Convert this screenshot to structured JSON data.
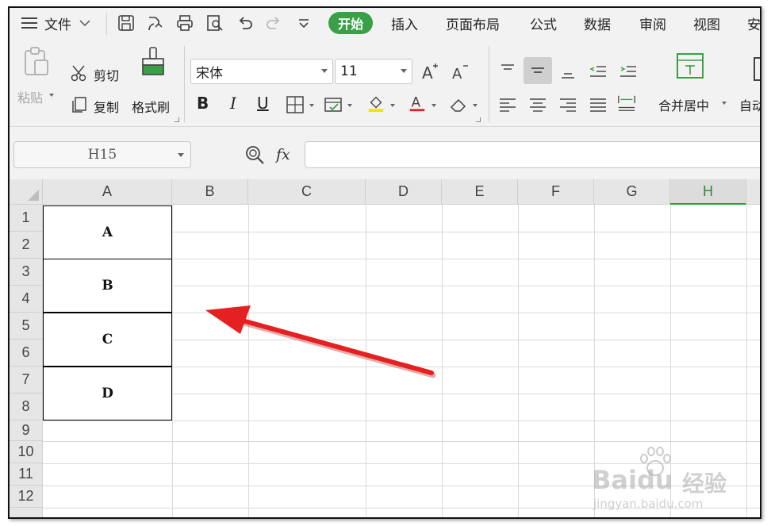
{
  "menu": {
    "hamburger_icon": "hamburger-menu-icon",
    "file_label": "文件",
    "tabs": [
      "开始",
      "插入",
      "页面布局",
      "公式",
      "数据",
      "审阅",
      "视图",
      "安"
    ],
    "active_tab": "开始",
    "active_color": "#3aa047"
  },
  "ribbon": {
    "paste_label": "粘贴",
    "cut_label": "剪切",
    "copy_label": "复制",
    "format_painter_label": "格式刷",
    "font_name": "宋体",
    "font_size": "11",
    "merge_center_label": "合并居中",
    "wrap_label": "自动"
  },
  "formula_bar": {
    "cell_ref": "H15",
    "fx_label": "fx",
    "formula_value": ""
  },
  "grid": {
    "columns": [
      "A",
      "B",
      "C",
      "D",
      "E",
      "F",
      "G",
      "H"
    ],
    "active_column": "H",
    "rows": [
      "1",
      "2",
      "3",
      "4",
      "5",
      "6",
      "7",
      "8",
      "9",
      "10",
      "11",
      "12"
    ],
    "merged_cells": [
      {
        "rows": "1-2",
        "value": "A"
      },
      {
        "rows": "3-4",
        "value": "B"
      },
      {
        "rows": "5-6",
        "value": "C"
      },
      {
        "rows": "7-8",
        "value": "D"
      }
    ]
  },
  "annotation": {
    "arrow_color": "#e02020"
  },
  "watermark": {
    "brand": "Baidu",
    "suffix": "经验",
    "url": "jingyan.baidu.com"
  }
}
